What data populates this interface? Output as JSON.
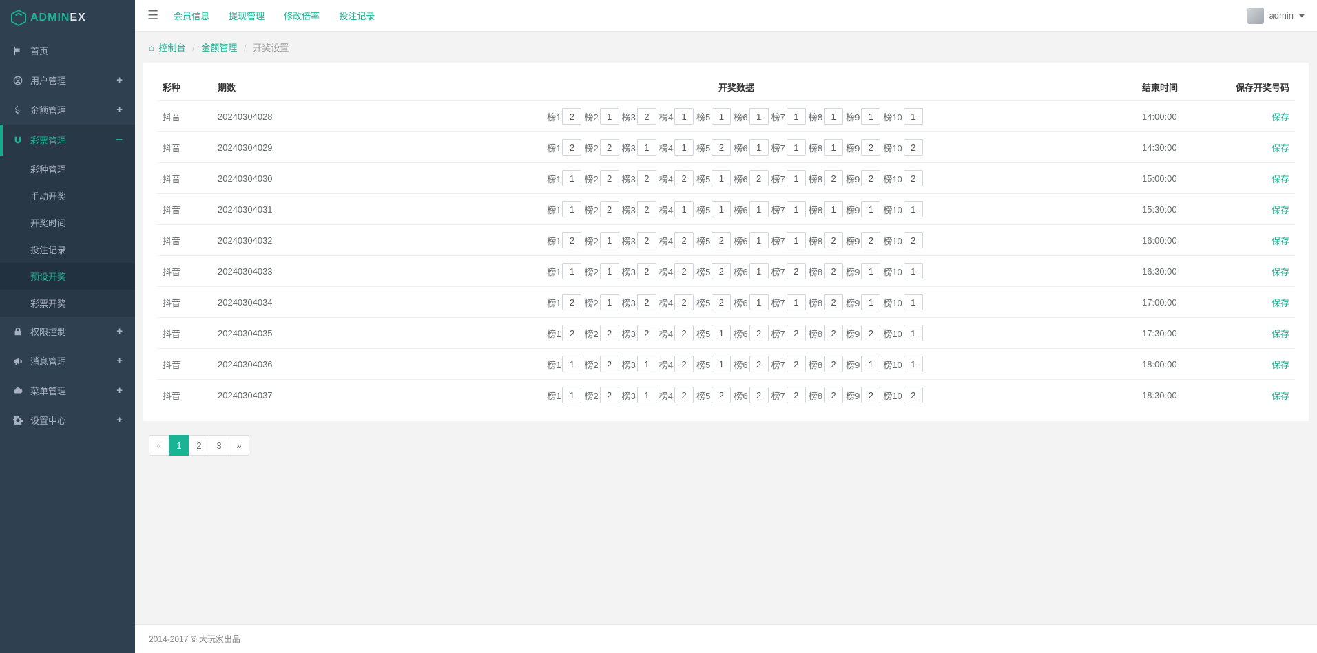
{
  "brand": {
    "part1": "ADMIN",
    "part2": "EX"
  },
  "sidebar": {
    "items": [
      {
        "label": "首页",
        "icon": "flag"
      },
      {
        "label": "用户管理",
        "icon": "user",
        "expandable": true
      },
      {
        "label": "金额管理",
        "icon": "dollar",
        "expandable": true
      },
      {
        "label": "彩票管理",
        "icon": "magnet",
        "expandable": true,
        "open": true,
        "children": [
          {
            "label": "彩种管理"
          },
          {
            "label": "手动开奖"
          },
          {
            "label": "开奖时间"
          },
          {
            "label": "投注记录"
          },
          {
            "label": "预设开奖",
            "active": true
          },
          {
            "label": "彩票开奖"
          }
        ]
      },
      {
        "label": "权限控制",
        "icon": "lock",
        "expandable": true
      },
      {
        "label": "消息管理",
        "icon": "bullhorn",
        "expandable": true
      },
      {
        "label": "菜单管理",
        "icon": "cloud",
        "expandable": true
      },
      {
        "label": "设置中心",
        "icon": "cog",
        "expandable": true
      }
    ]
  },
  "topbar": {
    "tabs": [
      "会员信息",
      "提现管理",
      "修改倍率",
      "投注记录"
    ],
    "user": "admin"
  },
  "breadcrumb": {
    "home": "控制台",
    "mid": "金额管理",
    "current": "开奖设置"
  },
  "table": {
    "headers": {
      "type": "彩种",
      "period": "期数",
      "data": "开奖数据",
      "endtime": "结束时间",
      "save": "保存开奖号码"
    },
    "rank_prefix": "榜",
    "save_label": "保存",
    "rows": [
      {
        "type": "抖音",
        "period": "20240304028",
        "endtime": "14:00:00",
        "values": [
          "2",
          "1",
          "2",
          "1",
          "1",
          "1",
          "1",
          "1",
          "1",
          "1"
        ]
      },
      {
        "type": "抖音",
        "period": "20240304029",
        "endtime": "14:30:00",
        "values": [
          "2",
          "2",
          "1",
          "1",
          "2",
          "1",
          "1",
          "1",
          "2",
          "2"
        ]
      },
      {
        "type": "抖音",
        "period": "20240304030",
        "endtime": "15:00:00",
        "values": [
          "1",
          "2",
          "2",
          "2",
          "1",
          "2",
          "1",
          "2",
          "2",
          "2"
        ]
      },
      {
        "type": "抖音",
        "period": "20240304031",
        "endtime": "15:30:00",
        "values": [
          "1",
          "2",
          "2",
          "1",
          "1",
          "1",
          "1",
          "1",
          "1",
          "1"
        ]
      },
      {
        "type": "抖音",
        "period": "20240304032",
        "endtime": "16:00:00",
        "values": [
          "2",
          "1",
          "2",
          "2",
          "2",
          "1",
          "1",
          "2",
          "2",
          "2"
        ]
      },
      {
        "type": "抖音",
        "period": "20240304033",
        "endtime": "16:30:00",
        "values": [
          "1",
          "1",
          "2",
          "2",
          "2",
          "1",
          "2",
          "2",
          "1",
          "1"
        ]
      },
      {
        "type": "抖音",
        "period": "20240304034",
        "endtime": "17:00:00",
        "values": [
          "2",
          "1",
          "2",
          "2",
          "2",
          "1",
          "1",
          "2",
          "1",
          "1"
        ]
      },
      {
        "type": "抖音",
        "period": "20240304035",
        "endtime": "17:30:00",
        "values": [
          "2",
          "2",
          "2",
          "2",
          "1",
          "2",
          "2",
          "2",
          "2",
          "1"
        ]
      },
      {
        "type": "抖音",
        "period": "20240304036",
        "endtime": "18:00:00",
        "values": [
          "1",
          "2",
          "1",
          "2",
          "1",
          "2",
          "2",
          "2",
          "1",
          "1"
        ]
      },
      {
        "type": "抖音",
        "period": "20240304037",
        "endtime": "18:30:00",
        "values": [
          "1",
          "2",
          "1",
          "2",
          "2",
          "2",
          "2",
          "2",
          "2",
          "2"
        ]
      }
    ]
  },
  "pagination": {
    "prev": "«",
    "pages": [
      "1",
      "2",
      "3"
    ],
    "next": "»",
    "active": "1"
  },
  "footer": "2014-2017 © 大玩家出品"
}
